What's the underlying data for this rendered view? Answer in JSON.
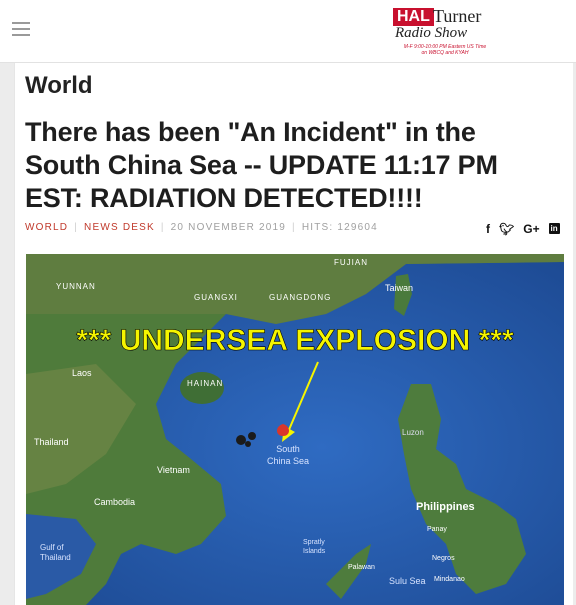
{
  "logo": {
    "hal": "HAL",
    "turner": "Turner",
    "radio_show": "Radio Show",
    "schedule_line1": "M-F 9:00-10:00 PM Eastern US Time",
    "schedule_line2": "on WBCQ and KYAH"
  },
  "article": {
    "section": "World",
    "title": "There has been \"An Incident\" in the South China Sea -- UPDATE 11:17 PM EST: RADIATION DETECTED!!!!",
    "meta": {
      "category": "WORLD",
      "desk": "NEWS DESK",
      "date": "20 NOVEMBER 2019",
      "hits": "HITS: 129604"
    },
    "share_icons": [
      "facebook-icon",
      "twitter-icon",
      "google-plus-icon",
      "linkedin-icon"
    ]
  },
  "map": {
    "banner": "*** UNDERSEA EXPLOSION ***",
    "labels": {
      "fujian": "FUJIAN",
      "yunnan": "YUNNAN",
      "taiwan": "Taiwan",
      "guangxi": "GUANGXI",
      "guangdong": "GUANGDONG",
      "laos": "Laos",
      "hainan": "HAINAN",
      "luzon": "Luzon",
      "thailand": "Thailand",
      "south": "South",
      "china_sea": "China Sea",
      "vietnam": "Vietnam",
      "cambodia": "Cambodia",
      "philippines": "Philippines",
      "panay": "Panay",
      "gulf_of": "Gulf of",
      "thailand2": "Thailand",
      "spratly": "Spratly",
      "islands": "Islands",
      "negros": "Negros",
      "palawan": "Palawan",
      "sulu_sea": "Sulu Sea",
      "mindanao": "Mindanao"
    },
    "colors": {
      "banner": "#f5f500",
      "sea": "#2457a8",
      "land": "#4e7a3a",
      "pin": "#d9362b"
    }
  }
}
